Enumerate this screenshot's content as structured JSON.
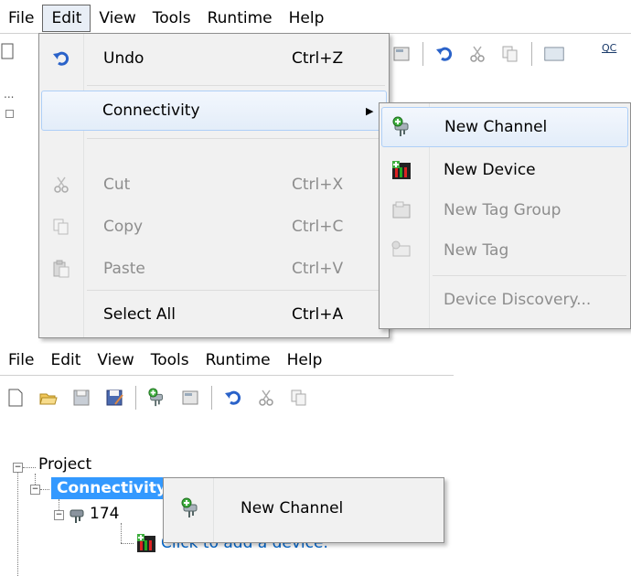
{
  "top": {
    "menubar": [
      "File",
      "Edit",
      "View",
      "Tools",
      "Runtime",
      "Help"
    ],
    "edit_menu": {
      "undo": {
        "label": "Undo",
        "shortcut": "Ctrl+Z"
      },
      "connectivity": {
        "label": "Connectivity",
        "arrow": "▶"
      },
      "cut": {
        "label": "Cut",
        "shortcut": "Ctrl+X"
      },
      "copy": {
        "label": "Copy",
        "shortcut": "Ctrl+C"
      },
      "paste": {
        "label": "Paste",
        "shortcut": "Ctrl+V"
      },
      "select_all": {
        "label": "Select All",
        "shortcut": "Ctrl+A"
      }
    },
    "submenu": {
      "new_channel": "New Channel",
      "new_device": "New Device",
      "new_tag_group": "New Tag Group",
      "new_tag": "New Tag",
      "device_discovery": "Device Discovery..."
    },
    "qc_label": "QC",
    "tree_ellipsis": "..."
  },
  "bottom": {
    "menubar": [
      "File",
      "Edit",
      "View",
      "Tools",
      "Runtime",
      "Help"
    ],
    "tree": {
      "project": "Project",
      "connectivity": "Connectivity",
      "channel_prefix": "174",
      "add_device": "Click to add a device."
    },
    "context_menu": {
      "new_channel": "New Channel"
    }
  },
  "colors": {
    "selection": "#3399ff",
    "link": "#0066cc",
    "menu_bg": "#f1f1f1",
    "highlight_border": "#aecff7"
  }
}
